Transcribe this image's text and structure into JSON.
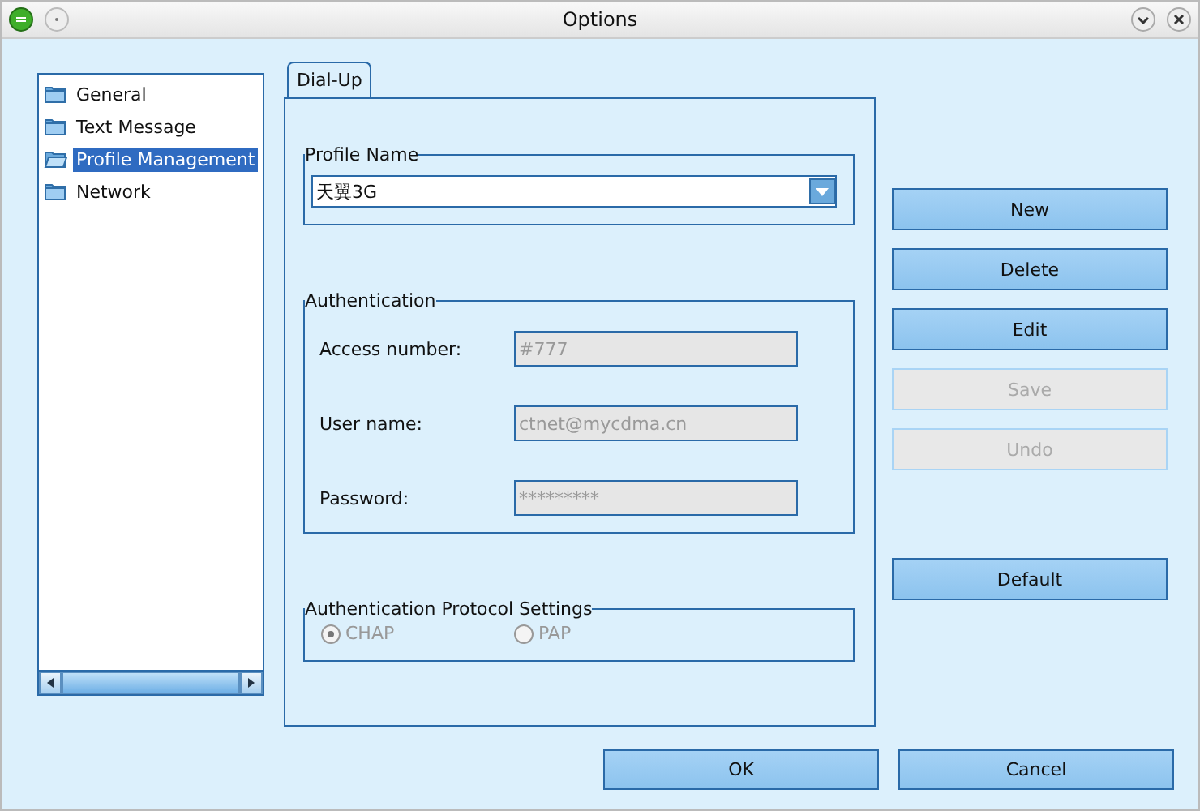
{
  "window": {
    "title": "Options"
  },
  "sidebar": {
    "items": [
      {
        "label": "General",
        "selected": false,
        "expanded": false
      },
      {
        "label": "Text Message",
        "selected": false,
        "expanded": false
      },
      {
        "label": "Profile Management",
        "selected": true,
        "expanded": true
      },
      {
        "label": "Network",
        "selected": false,
        "expanded": false
      }
    ]
  },
  "tabs": [
    {
      "label": "Dial-Up",
      "selected": true
    }
  ],
  "profile_group": {
    "title": "Profile Name",
    "value": "天翼3G"
  },
  "auth_group": {
    "title": "Authentication",
    "fields": [
      {
        "label": "Access number:",
        "value": "#777",
        "disabled": true
      },
      {
        "label": "User name:",
        "value": "ctnet@mycdma.cn",
        "disabled": true
      },
      {
        "label": "Password:",
        "value": "*********",
        "disabled": true
      }
    ]
  },
  "protocol_group": {
    "title": "Authentication Protocol Settings",
    "options": [
      {
        "label": "CHAP",
        "selected": true,
        "disabled": true
      },
      {
        "label": "PAP",
        "selected": false,
        "disabled": true
      }
    ]
  },
  "side_buttons": [
    {
      "label": "New",
      "disabled": false
    },
    {
      "label": "Delete",
      "disabled": false
    },
    {
      "label": "Edit",
      "disabled": false
    },
    {
      "label": "Save",
      "disabled": true
    },
    {
      "label": "Undo",
      "disabled": true
    },
    {
      "label": "Default",
      "disabled": false
    }
  ],
  "buttons": [
    {
      "label": "OK"
    },
    {
      "label": "Cancel"
    }
  ]
}
